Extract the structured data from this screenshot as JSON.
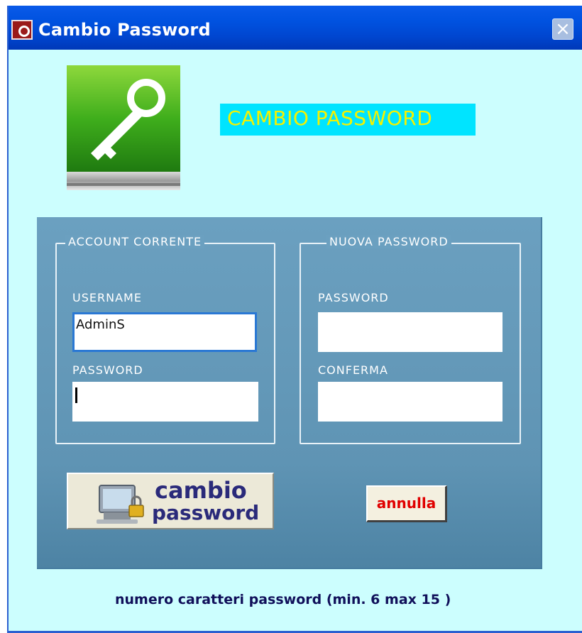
{
  "window": {
    "title": "Cambio Password",
    "close_label": "×"
  },
  "banner": {
    "text": "CAMBIO PASSWORD"
  },
  "account_corrente": {
    "legend": "ACCOUNT CORRENTE",
    "username_label": "USERNAME",
    "username_value": "AdminS",
    "password_label": "PASSWORD",
    "password_value": ""
  },
  "nuova_password": {
    "legend": "NUOVA PASSWORD",
    "password_label": "PASSWORD",
    "password_value": "",
    "confirm_label": "CONFERMA",
    "confirm_value": ""
  },
  "buttons": {
    "cambio_line1": "cambio",
    "cambio_line2": "password",
    "annulla": "annulla"
  },
  "footer": {
    "note": "numero caratteri password (min. 6 max 15 )"
  },
  "icons": {
    "app": "form-icon",
    "logo": "key-icon",
    "cambio_button": "computer-lock-icon"
  },
  "colors": {
    "title_bar": "#0052e0",
    "window_bg": "#ccfefe",
    "banner_bg": "#00e4ff",
    "banner_text": "#f4f200",
    "panel_bg": "#6ba0c0",
    "annulla_text": "#e00000",
    "footer_text": "#10105a"
  }
}
